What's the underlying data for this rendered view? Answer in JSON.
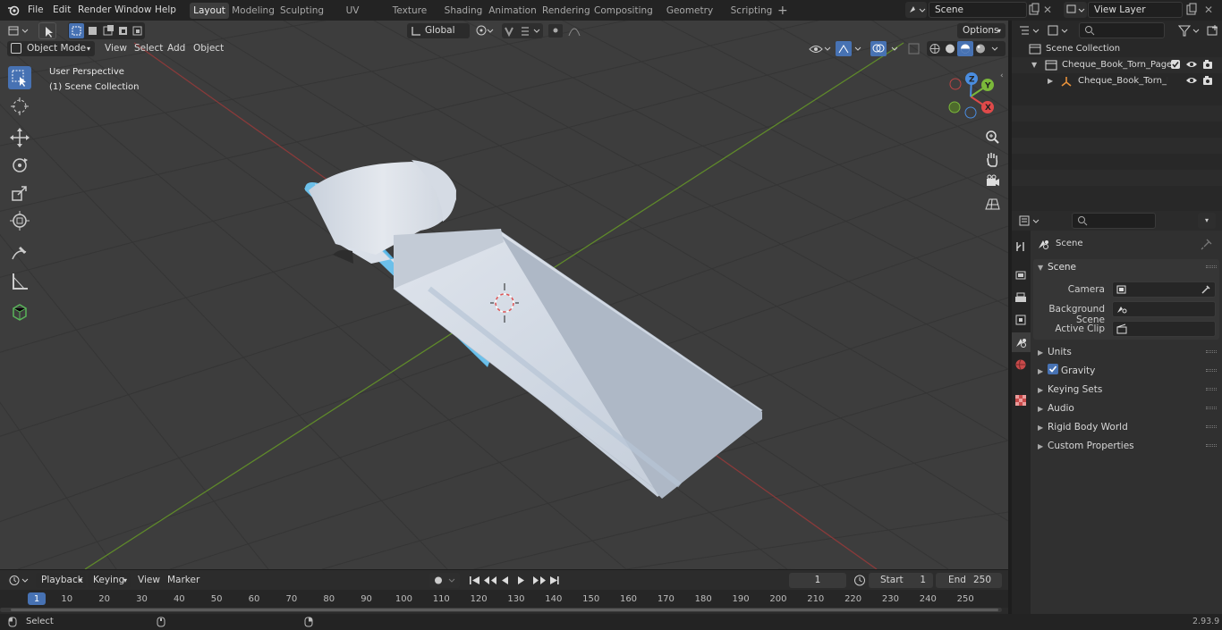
{
  "menu": [
    "File",
    "Edit",
    "Render",
    "Window",
    "Help"
  ],
  "workspaces": [
    "Layout",
    "Modeling",
    "Sculpting",
    "UV Editing",
    "Texture Paint",
    "Shading",
    "Animation",
    "Rendering",
    "Compositing",
    "Geometry Nodes",
    "Scripting"
  ],
  "active_workspace": "Layout",
  "scene_field": "Scene",
  "view_layer_field": "View Layer",
  "viewport": {
    "mode": "Object Mode",
    "menus": [
      "View",
      "Select",
      "Add",
      "Object"
    ],
    "transform_orientation": "Global",
    "options_label": "Options",
    "perspective_label": "User Perspective",
    "collection_label": "(1) Scene Collection",
    "gizmo_axes": [
      "X",
      "Y",
      "Z"
    ]
  },
  "outliner": {
    "root": "Scene Collection",
    "items": [
      {
        "label": "Cheque_Book_Torn_Pages"
      },
      {
        "label": "Cheque_Book_Torn_Page"
      }
    ]
  },
  "properties": {
    "context": "Scene",
    "panel": "Scene",
    "fields": [
      {
        "label": "Camera"
      },
      {
        "label": "Background Scene"
      },
      {
        "label": "Active Clip"
      }
    ],
    "subpanels": [
      "Units",
      "Gravity",
      "Keying Sets",
      "Audio",
      "Rigid Body World",
      "Custom Properties"
    ],
    "gravity_checked": true
  },
  "timeline": {
    "menus": [
      "Playback",
      "Keying",
      "View",
      "Marker"
    ],
    "current_frame": "1",
    "start_label": "Start",
    "start": "1",
    "end_label": "End",
    "end": "250",
    "ticks": [
      "1",
      "10",
      "20",
      "30",
      "40",
      "50",
      "60",
      "70",
      "80",
      "90",
      "100",
      "110",
      "120",
      "130",
      "140",
      "150",
      "160",
      "170",
      "180",
      "190",
      "200",
      "210",
      "220",
      "230",
      "240",
      "250"
    ]
  },
  "status": {
    "left": "Select",
    "version": "2.93.9"
  },
  "colors": {
    "accent": "#4772b3",
    "x_axis": "#e04a4a",
    "y_axis": "#7bb83a",
    "z_axis": "#4a8de0"
  }
}
